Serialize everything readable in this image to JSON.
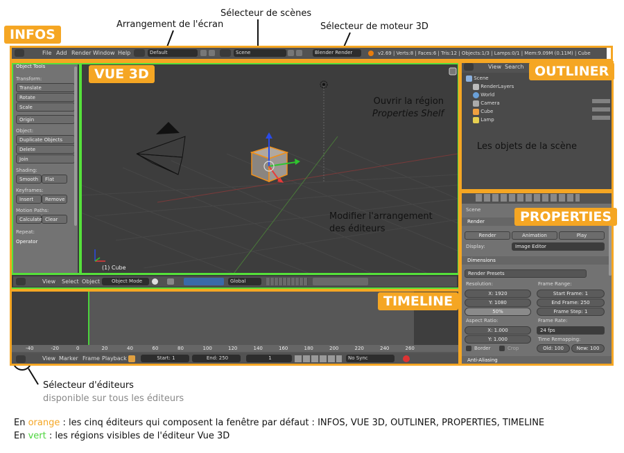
{
  "annotations": {
    "ecran": "Arrangement de l'écran",
    "scenes": "Sélecteur de scènes",
    "moteur": "Sélecteur de moteur 3D",
    "shelf_line1": "Ouvrir la région",
    "shelf_line2": "Properties Shelf",
    "objets": "Les objets de la scène",
    "arrangement_line1": "Modifier l'arrangement",
    "arrangement_line2": "des éditeurs",
    "editeurs_line1": "Sélecteur d'éditeurs",
    "editeurs_line2": "disponible sur tous les éditeurs"
  },
  "labels": {
    "infos": "INFOS",
    "vue3d": "VUE 3D",
    "outliner": "OUTLINER",
    "properties": "PROPERTIES",
    "timeline": "TIMELINE"
  },
  "legend": {
    "line1_prefix": "En ",
    "line1_color": "orange",
    "line1_rest": " : les cinq éditeurs qui composent la fenêtre par défaut : INFOS, VUE 3D, OUTLINER, PROPERTIES, TIMELINE",
    "line2_prefix": "En ",
    "line2_color": "vert",
    "line2_rest": " : les régions visibles de l'éditeur Vue 3D"
  },
  "colors": {
    "orange": "#f5a623",
    "green": "#55e13a",
    "grey_text": "#888888"
  },
  "info_header": {
    "menus": [
      "File",
      "Add",
      "Render",
      "Window",
      "Help"
    ],
    "screen_layout": "Default",
    "scene": "Scene",
    "engine": "Blender Render",
    "stats": "v2.69 | Verts:8 | Faces:6 | Tris:12 | Objects:1/3 | Lamps:0/1 | Mem:9.09M (0.11M) | Cube"
  },
  "tool_shelf": {
    "title": "Object Tools",
    "transform_label": "Transform:",
    "translate": "Translate",
    "rotate": "Rotate",
    "scale": "Scale",
    "origin": "Origin",
    "object_label": "Object:",
    "duplicate": "Duplicate Objects",
    "delete": "Delete",
    "join": "Join",
    "shading_label": "Shading:",
    "smooth": "Smooth",
    "flat": "Flat",
    "keyframes_label": "Keyframes:",
    "insert": "Insert",
    "remove": "Remove",
    "motion_label": "Motion Paths:",
    "calculate": "Calculate",
    "clear": "Clear",
    "repeat_label": "Repeat:",
    "operator": "Operator"
  },
  "viewport": {
    "object_name": "(1) Cube"
  },
  "view3d_header": {
    "menus": [
      "View",
      "Select",
      "Object"
    ],
    "mode": "Object Mode",
    "orientation": "Global"
  },
  "outliner": {
    "menus": [
      "View",
      "Search"
    ],
    "items": [
      "Scene",
      "RenderLayers",
      "World",
      "Camera",
      "Cube",
      "Lamp"
    ]
  },
  "properties": {
    "scene": "Scene",
    "render_panel": "Render",
    "render_btn": "Render",
    "animation_btn": "Animation",
    "play_btn": "Play",
    "display_label": "Display:",
    "display_value": "Image Editor",
    "dimensions_panel": "Dimensions",
    "render_presets": "Render Presets",
    "resolution_label": "Resolution:",
    "res_x": "X: 1920",
    "res_y": "Y: 1080",
    "res_pct": "50%",
    "frame_range_label": "Frame Range:",
    "start_frame": "Start Frame: 1",
    "end_frame": "End Frame: 250",
    "frame_step": "Frame Step: 1",
    "aspect_label": "Aspect Ratio:",
    "asp_x": "X: 1.000",
    "asp_y": "Y: 1.000",
    "frame_rate_label": "Frame Rate:",
    "fps": "24 fps",
    "time_remap_label": "Time Remapping:",
    "old": "Old: 100",
    "new": "New: 100",
    "border": "Border",
    "crop": "Crop",
    "anti_aliasing": "Anti-Aliasing"
  },
  "timeline": {
    "ruler": [
      "-40",
      "-20",
      "0",
      "20",
      "40",
      "60",
      "80",
      "100",
      "120",
      "140",
      "160",
      "180",
      "200",
      "220",
      "240",
      "260"
    ],
    "menus": [
      "View",
      "Marker",
      "Frame",
      "Playback"
    ],
    "start": "Start: 1",
    "end": "End: 250",
    "current": "1",
    "sync": "No Sync"
  }
}
